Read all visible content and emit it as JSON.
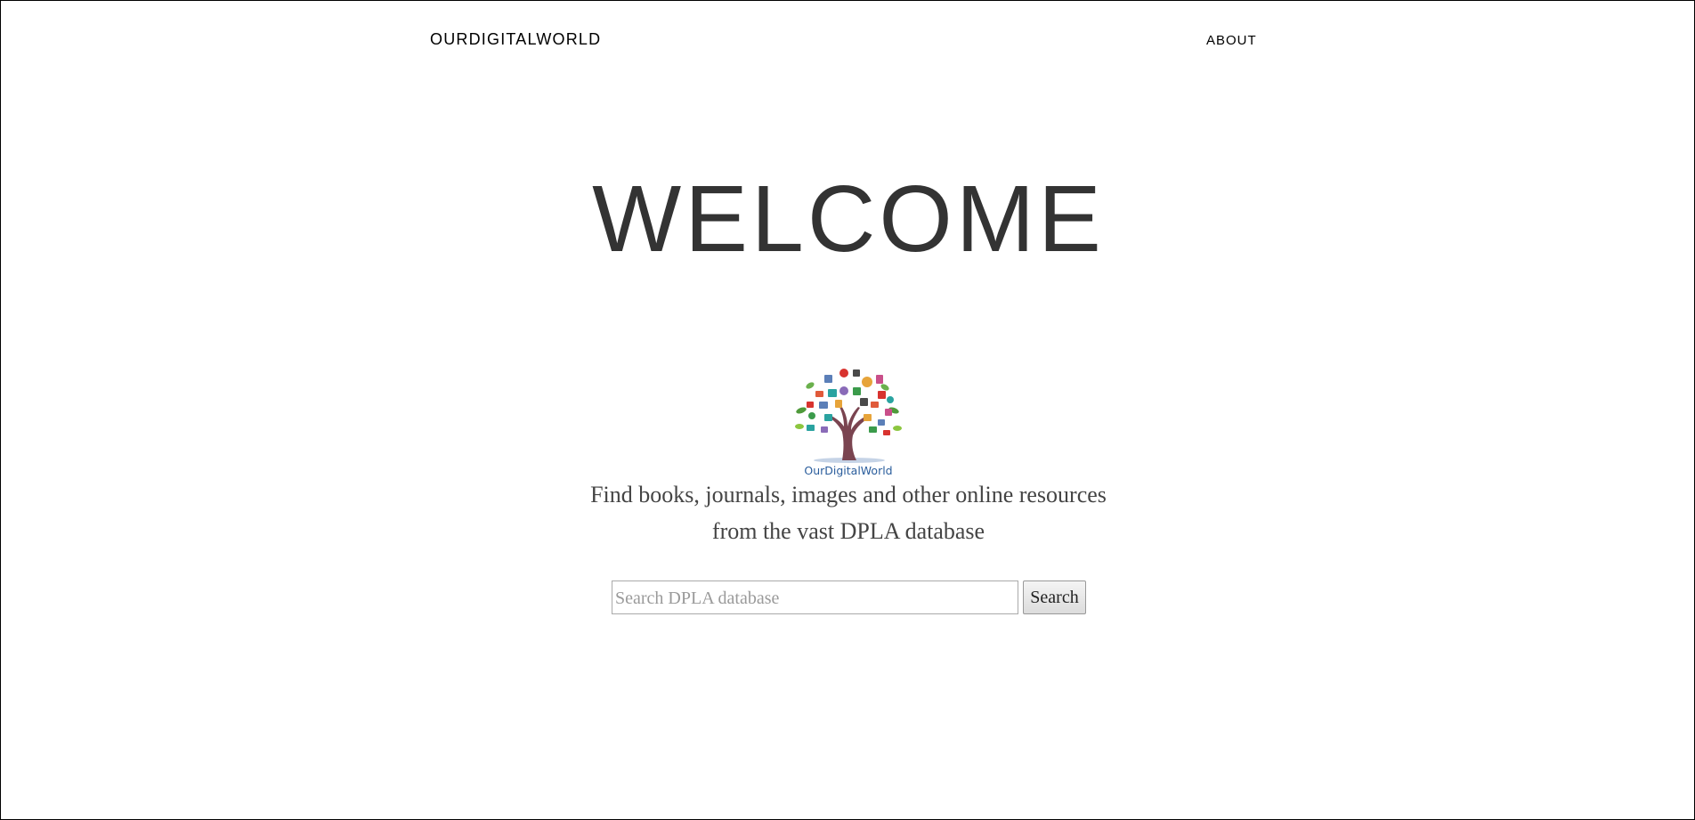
{
  "header": {
    "brand": "OURDIGITALWORLD",
    "nav_about": "ABOUT"
  },
  "hero": {
    "title": "WELCOME"
  },
  "logo": {
    "caption": "OurDigitalWorld",
    "icon": "tree-of-media-icons"
  },
  "tagline": {
    "line1": "Find books, journals, images and other online resources",
    "line2": "from the vast DPLA database"
  },
  "search": {
    "placeholder": "Search DPLA database",
    "value": "",
    "button_label": "Search"
  },
  "colors": {
    "heading": "#333333",
    "tagline": "#444444",
    "logo_text": "#2a5d9c",
    "tree_trunk": "#7a4450"
  }
}
